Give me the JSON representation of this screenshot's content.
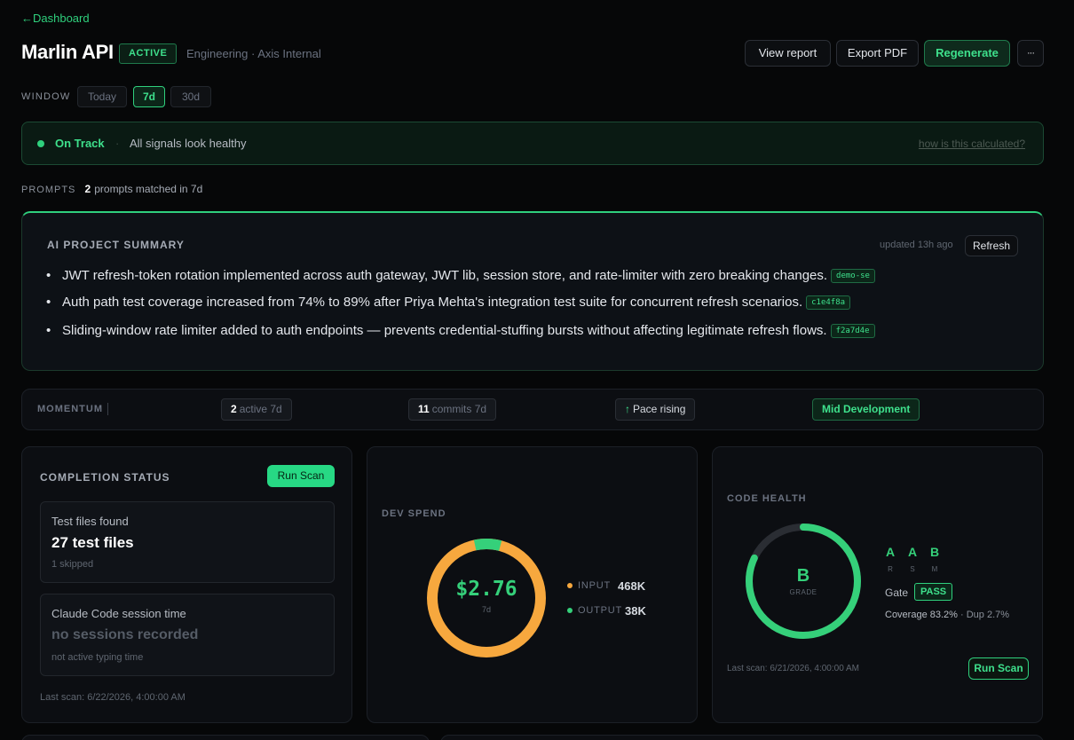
{
  "header": {
    "back_label": "Dashboard",
    "title": "Marlin API",
    "status_badge": "ACTIVE",
    "subtitle": "Engineering · Axis Internal",
    "actions": {
      "view_report": "View report",
      "export_pdf": "Export PDF",
      "regenerate": "Regenerate",
      "more": "···"
    }
  },
  "window": {
    "label": "WINDOW",
    "options": [
      "Today",
      "7d",
      "30d"
    ],
    "selected": "7d"
  },
  "banner": {
    "status": "On Track",
    "separator": "·",
    "message": "All signals look healthy",
    "link": "how is this calculated?"
  },
  "prompts": {
    "label": "PROMPTS",
    "count": "2",
    "text": "prompts matched in 7d"
  },
  "summary": {
    "title": "AI PROJECT SUMMARY",
    "updated": "updated 13h ago",
    "refresh": "Refresh",
    "bullets": [
      {
        "text": "JWT refresh-token rotation implemented across auth gateway, JWT lib, session store, and rate-limiter with zero breaking changes.",
        "hash": "demo-se"
      },
      {
        "text": "Auth path test coverage increased from 74% to 89% after Priya Mehta's integration test suite for concurrent refresh scenarios.",
        "hash": "c1e4f8a"
      },
      {
        "text": "Sliding-window rate limiter added to auth endpoints — prevents credential-stuffing bursts without affecting legitimate refresh flows.",
        "hash": "f2a7d4e"
      }
    ]
  },
  "momentum": {
    "label": "MOMENTUM",
    "active_count": "2",
    "active_label": "active 7d",
    "commits_count": "11",
    "commits_label": "commits 7d",
    "pace_arrow": "↑",
    "pace": "Pace rising",
    "stage": "Mid Development"
  },
  "completion": {
    "title": "COMPLETION STATUS",
    "run_scan": "Run Scan",
    "tests": {
      "label": "Test files found",
      "value": "27 test files",
      "sub": "1 skipped"
    },
    "session": {
      "label": "Claude Code session time",
      "value": "no sessions recorded",
      "sub": "not active typing time"
    },
    "last_scan": "Last scan: 6/22/2026, 4:00:00 AM"
  },
  "dev_spend": {
    "title": "DEV SPEND",
    "total": "$2.76",
    "period": "7d",
    "input_label": "INPUT",
    "input_value": "468K",
    "input_tokens": 468000,
    "output_label": "OUTPUT",
    "output_value": "38K",
    "output_tokens": 38000,
    "colors": {
      "input": "#f7a83e",
      "output": "#35d07a"
    }
  },
  "code_health": {
    "title": "CODE HEALTH",
    "grade": "B",
    "grade_label": "GRADE",
    "grade_fraction": 0.82,
    "ratings": [
      {
        "grade": "A",
        "key": "R"
      },
      {
        "grade": "A",
        "key": "S"
      },
      {
        "grade": "B",
        "key": "M"
      }
    ],
    "gate_label": "Gate",
    "gate_value": "PASS",
    "coverage": "Coverage 83.2%",
    "dup": "· Dup 2.7%",
    "last_scan": "Last scan: 6/21/2026, 4:00:00 AM",
    "run_scan": "Run Scan",
    "color": "#35d07a"
  }
}
